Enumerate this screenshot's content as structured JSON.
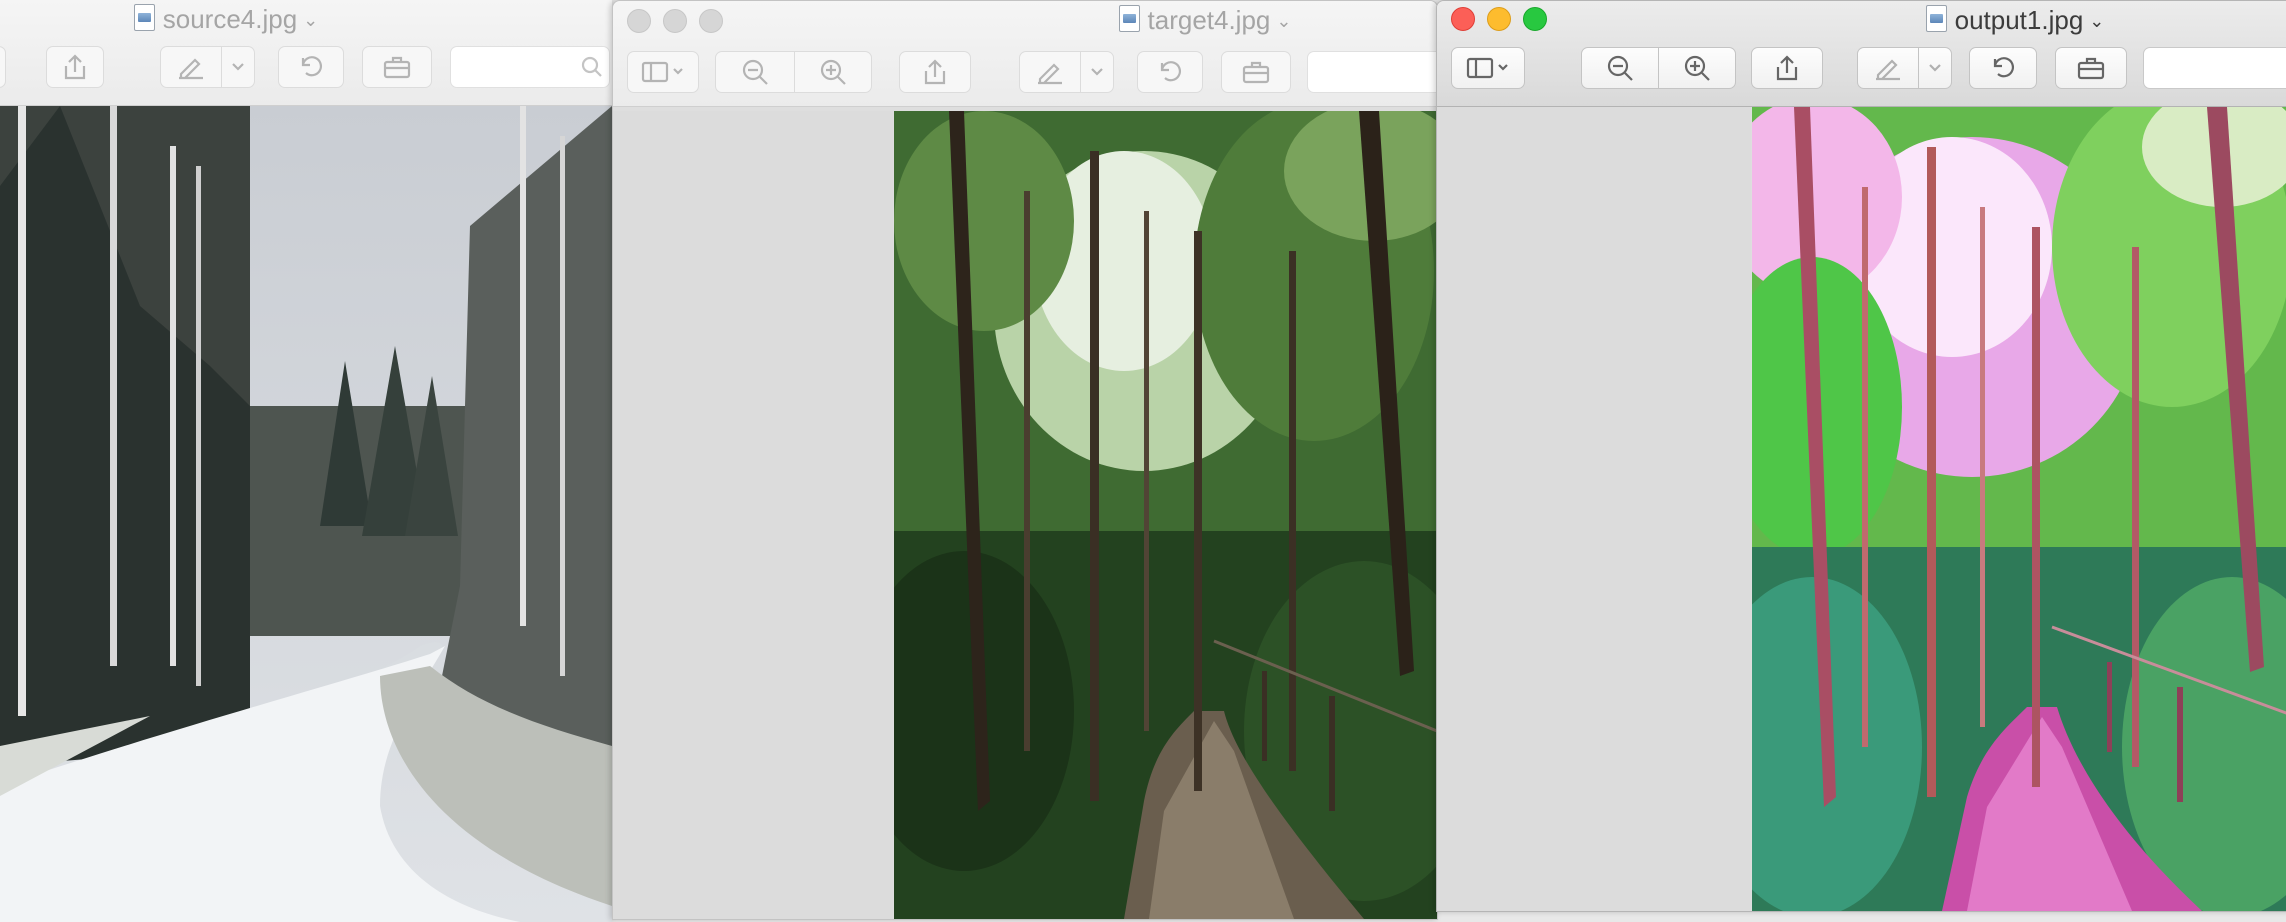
{
  "windows": [
    {
      "id": "win-source",
      "title": "source4.jpg",
      "active": false
    },
    {
      "id": "win-target",
      "title": "target4.jpg",
      "active": false
    },
    {
      "id": "win-output",
      "title": "output1.jpg",
      "active": true
    }
  ],
  "icons": {
    "sidebar": "sidebar-toggle-icon",
    "zoom_out": "zoom-out-icon",
    "zoom_in": "zoom-in-icon",
    "share": "share-icon",
    "markup": "markup-pen-icon",
    "rotate": "rotate-left-icon",
    "toolbox": "toolbox-icon",
    "search": "search-icon"
  },
  "colors": {
    "close": "#fc5f57",
    "minimize": "#fdbc2e",
    "maximize": "#28c840"
  },
  "images": {
    "source": "snowy forest road",
    "target": "green forest path",
    "output": "color-transferred forest path"
  }
}
